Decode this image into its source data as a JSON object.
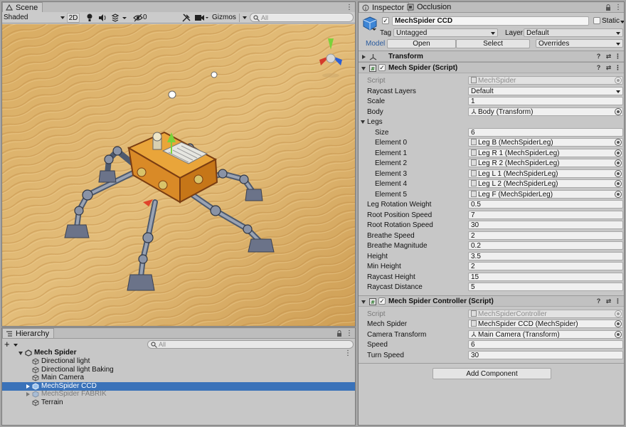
{
  "scene": {
    "tab_label": "Scene",
    "shading_mode": "Shaded",
    "btn_2d": "2D",
    "hidden_count": "0",
    "gizmos_label": "Gizmos",
    "search_placeholder": "All",
    "icons": [
      "light-icon",
      "audio-icon",
      "effects-icon",
      "visibility-icon",
      "tools-icon",
      "camera-icon"
    ]
  },
  "hierarchy": {
    "tab_label": "Hierarchy",
    "search_placeholder": "All",
    "root": "Mech Spider",
    "items": [
      {
        "label": "Directional light",
        "selected": false,
        "dim": false
      },
      {
        "label": "Directional light Baking",
        "selected": false,
        "dim": false
      },
      {
        "label": "Main Camera",
        "selected": false,
        "dim": false
      },
      {
        "label": "MechSpider CCD",
        "selected": true,
        "dim": false
      },
      {
        "label": "MechSpider FABRIK",
        "selected": false,
        "dim": true
      },
      {
        "label": "Terrain",
        "selected": false,
        "dim": false
      }
    ]
  },
  "inspector": {
    "tab_label": "Inspector",
    "tab2_label": "Occlusion",
    "object_name": "MechSpider CCD",
    "static_label": "Static",
    "tag_label": "Tag",
    "tag_value": "Untagged",
    "layer_label": "Layer",
    "layer_value": "Default",
    "model_label": "Model",
    "open_label": "Open",
    "select_label": "Select",
    "overrides_label": "Overrides",
    "transform_label": "Transform",
    "mech_spider": {
      "header": "Mech Spider (Script)",
      "script_label": "Script",
      "script_value": "MechSpider",
      "raycast_layers_label": "Raycast Layers",
      "raycast_layers_value": "Default",
      "scale_label": "Scale",
      "scale_value": "1",
      "body_label": "Body",
      "body_value": "Body (Transform)",
      "legs_label": "Legs",
      "size_label": "Size",
      "size_value": "6",
      "elements": [
        {
          "label": "Element 0",
          "value": "Leg B (MechSpiderLeg)"
        },
        {
          "label": "Element 1",
          "value": "Leg R 1 (MechSpiderLeg)"
        },
        {
          "label": "Element 2",
          "value": "Leg R 2 (MechSpiderLeg)"
        },
        {
          "label": "Element 3",
          "value": "Leg L 1 (MechSpiderLeg)"
        },
        {
          "label": "Element 4",
          "value": "Leg L 2 (MechSpiderLeg)"
        },
        {
          "label": "Element 5",
          "value": "Leg F (MechSpiderLeg)"
        }
      ],
      "props": [
        {
          "label": "Leg Rotation Weight",
          "value": "0.5"
        },
        {
          "label": "Root Position Speed",
          "value": "7"
        },
        {
          "label": "Root Rotation Speed",
          "value": "30"
        },
        {
          "label": "Breathe Speed",
          "value": "2"
        },
        {
          "label": "Breathe Magnitude",
          "value": "0.2"
        },
        {
          "label": "Height",
          "value": "3.5"
        },
        {
          "label": "Min Height",
          "value": "2"
        },
        {
          "label": "Raycast Height",
          "value": "15"
        },
        {
          "label": "Raycast Distance",
          "value": "5"
        }
      ]
    },
    "controller": {
      "header": "Mech Spider Controller (Script)",
      "script_label": "Script",
      "script_value": "MechSpiderController",
      "mech_spider_label": "Mech Spider",
      "mech_spider_value": "MechSpider CCD (MechSpider)",
      "camera_label": "Camera Transform",
      "camera_value": "Main Camera (Transform)",
      "speed_label": "Speed",
      "speed_value": "6",
      "turn_label": "Turn Speed",
      "turn_value": "30"
    },
    "add_component": "Add Component"
  },
  "colors": {
    "selection": "#3a72b9",
    "panel": "#c7c7c7",
    "sand": "#d9b26b"
  }
}
